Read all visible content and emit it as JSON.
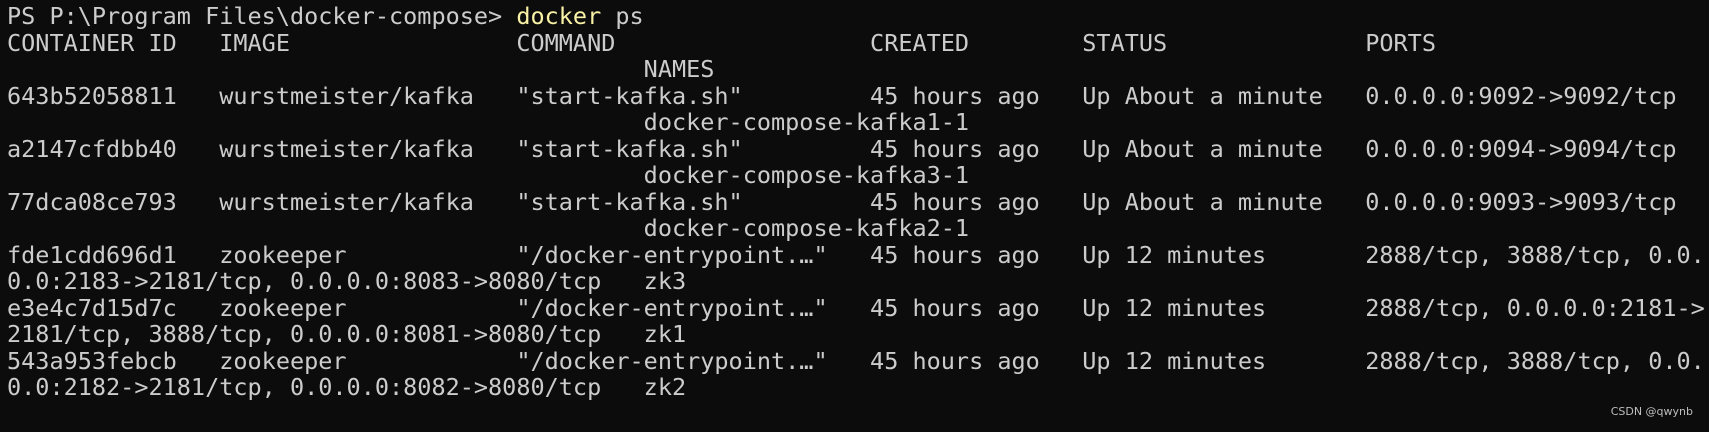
{
  "prompt": {
    "text": "PS P:\\Program Files\\docker-compose> ",
    "command": "docker",
    "args": " ps"
  },
  "lines": [
    "CONTAINER ID   IMAGE                COMMAND                  CREATED        STATUS              PORTS",
    "                                             NAMES",
    "643b52058811   wurstmeister/kafka   \"start-kafka.sh\"         45 hours ago   Up About a minute   0.0.0.0:9092->9092/tcp",
    "                                             docker-compose-kafka1-1",
    "a2147cfdbb40   wurstmeister/kafka   \"start-kafka.sh\"         45 hours ago   Up About a minute   0.0.0.0:9094->9094/tcp",
    "                                             docker-compose-kafka3-1",
    "77dca08ce793   wurstmeister/kafka   \"start-kafka.sh\"         45 hours ago   Up About a minute   0.0.0.0:9093->9093/tcp",
    "                                             docker-compose-kafka2-1",
    "fde1cdd696d1   zookeeper            \"/docker-entrypoint.…\"   45 hours ago   Up 12 minutes       2888/tcp, 3888/tcp, 0.0.",
    "0.0:2183->2181/tcp, 0.0.0.0:8083->8080/tcp   zk3",
    "e3e4c7d15d7c   zookeeper            \"/docker-entrypoint.…\"   45 hours ago   Up 12 minutes       2888/tcp, 0.0.0.0:2181->",
    "2181/tcp, 3888/tcp, 0.0.0.0:8081->8080/tcp   zk1",
    "543a953febcb   zookeeper            \"/docker-entrypoint.…\"   45 hours ago   Up 12 minutes       2888/tcp, 3888/tcp, 0.0.",
    "0.0:2182->2181/tcp, 0.0.0.0:8082->8080/tcp   zk2"
  ],
  "watermark": "CSDN @qwynb",
  "colors": {
    "background": "#0c0c0c",
    "foreground": "#cccccc",
    "command_highlight": "#f9f1a5"
  }
}
